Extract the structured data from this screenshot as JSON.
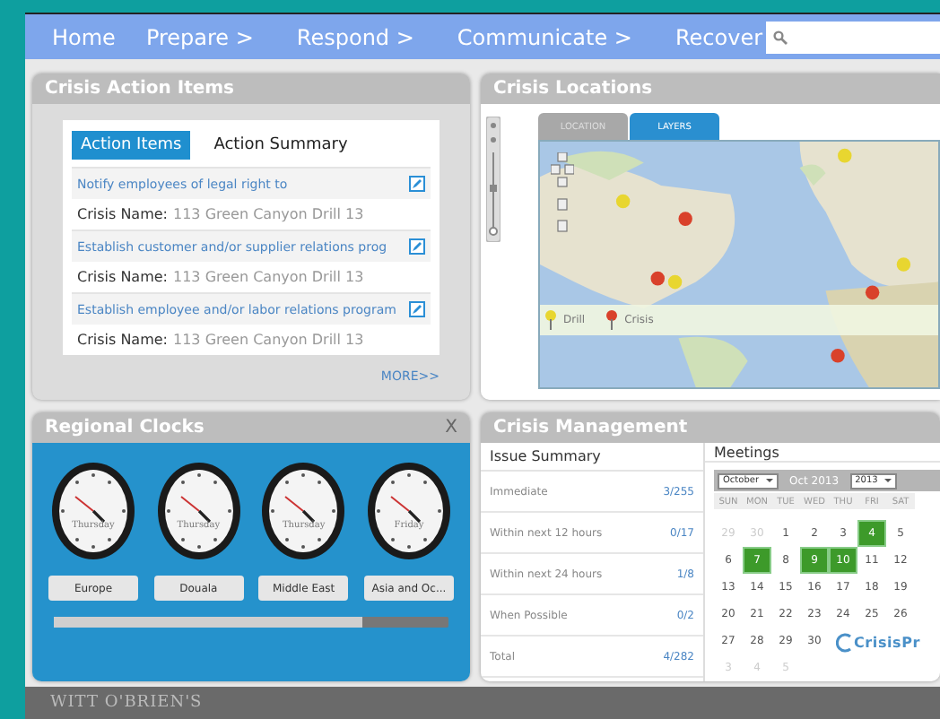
{
  "nav": {
    "items": [
      {
        "label": "Home",
        "kind": "home"
      },
      {
        "label": "Prepare >",
        "kind": "menu"
      },
      {
        "label": "Respond >",
        "kind": "menu"
      },
      {
        "label": "Communicate >",
        "kind": "menu"
      },
      {
        "label": "Recover",
        "kind": "menu"
      }
    ],
    "search": {
      "kind": "search"
    }
  },
  "action_items": {
    "title": "Crisis Action Items",
    "tabs": [
      {
        "label": "Action Items",
        "selected": true
      },
      {
        "label": "Action Summary",
        "selected": false
      }
    ],
    "items": [
      {
        "title": "Notify employees of legal right to",
        "crisis_label": "Crisis Name:",
        "crisis_name": "113 Green Canyon Drill 13"
      },
      {
        "title": "Establish customer and/or supplier relations prog",
        "crisis_label": "Crisis Name:",
        "crisis_name": "113 Green Canyon Drill 13"
      },
      {
        "title": "Establish employee and/or labor relations program",
        "crisis_label": "Crisis Name:",
        "crisis_name": "113 Green Canyon Drill 13"
      }
    ],
    "more": "MORE>>"
  },
  "crisis_locations": {
    "title": "Crisis Locations",
    "tabs": [
      {
        "label": "LOCATION",
        "selected": false
      },
      {
        "label": "LAYERS",
        "selected": true
      }
    ],
    "legend": [
      {
        "label": "Drill",
        "color": "#e8d630"
      },
      {
        "label": "Crisis",
        "color": "#d9412b"
      }
    ]
  },
  "regional_clocks": {
    "title": "Regional Clocks",
    "close": "X",
    "clocks": [
      {
        "day": "Thursday",
        "label": "Europe"
      },
      {
        "day": "Thursday",
        "label": "Douala"
      },
      {
        "day": "Thursday",
        "label": "Middle East"
      },
      {
        "day": "Friday",
        "label": "Asia and Oc..."
      }
    ],
    "progress": {
      "level": 0.78
    }
  },
  "crisis_management": {
    "title": "Crisis Management",
    "issue_summary": {
      "title": "Issue Summary",
      "rows": [
        {
          "label": "Immediate",
          "value": "3/255"
        },
        {
          "label": "Within next 12 hours",
          "value": "0/17"
        },
        {
          "label": "Within next 24 hours",
          "value": "1/8"
        },
        {
          "label": "When Possible",
          "value": "0/2"
        },
        {
          "label": "Total",
          "value": "4/282"
        }
      ]
    },
    "meetings": {
      "title": "Meetings",
      "month_select": "October",
      "heading": "Oct 2013",
      "year_select": "2013",
      "weekdays": [
        "SUN",
        "MON",
        "TUE",
        "WED",
        "THU",
        "FRI",
        "SAT"
      ],
      "weeks": [
        [
          {
            "day": "29",
            "muted": true,
            "selected": false
          },
          {
            "day": "30",
            "muted": true,
            "selected": false
          },
          {
            "day": "1",
            "muted": false,
            "selected": false
          },
          {
            "day": "2",
            "muted": false,
            "selected": false
          },
          {
            "day": "3",
            "muted": false,
            "selected": false
          },
          {
            "day": "4",
            "muted": false,
            "selected": true
          },
          {
            "day": "5",
            "muted": false,
            "selected": false
          }
        ],
        [
          {
            "day": "6",
            "muted": false,
            "selected": false
          },
          {
            "day": "7",
            "muted": false,
            "selected": true
          },
          {
            "day": "8",
            "muted": false,
            "selected": false
          },
          {
            "day": "9",
            "muted": false,
            "selected": true
          },
          {
            "day": "10",
            "muted": false,
            "selected": true
          },
          {
            "day": "11",
            "muted": false,
            "selected": false
          },
          {
            "day": "12",
            "muted": false,
            "selected": false
          }
        ],
        [
          {
            "day": "13",
            "muted": false,
            "selected": false
          },
          {
            "day": "14",
            "muted": false,
            "selected": false
          },
          {
            "day": "15",
            "muted": false,
            "selected": false
          },
          {
            "day": "16",
            "muted": false,
            "selected": false
          },
          {
            "day": "17",
            "muted": false,
            "selected": false
          },
          {
            "day": "18",
            "muted": false,
            "selected": false
          },
          {
            "day": "19",
            "muted": false,
            "selected": false
          }
        ],
        [
          {
            "day": "20",
            "muted": false,
            "selected": false
          },
          {
            "day": "21",
            "muted": false,
            "selected": false
          },
          {
            "day": "22",
            "muted": false,
            "selected": false
          },
          {
            "day": "23",
            "muted": false,
            "selected": false
          },
          {
            "day": "24",
            "muted": false,
            "selected": false
          },
          {
            "day": "25",
            "muted": false,
            "selected": false
          },
          {
            "day": "26",
            "muted": false,
            "selected": false
          }
        ],
        [
          {
            "day": "27",
            "muted": false,
            "selected": false
          },
          {
            "day": "28",
            "muted": false,
            "selected": false
          },
          {
            "day": "29",
            "muted": false,
            "selected": false
          },
          {
            "day": "30",
            "muted": false,
            "selected": false
          }
        ],
        [
          {
            "day": "3",
            "muted": true,
            "selected": false
          },
          {
            "day": "4",
            "muted": true,
            "selected": false
          },
          {
            "day": "5",
            "muted": true,
            "selected": false
          }
        ]
      ],
      "logo": "CrisisPr"
    }
  },
  "footer": {
    "brand": "WITT O'BRIEN'S"
  }
}
